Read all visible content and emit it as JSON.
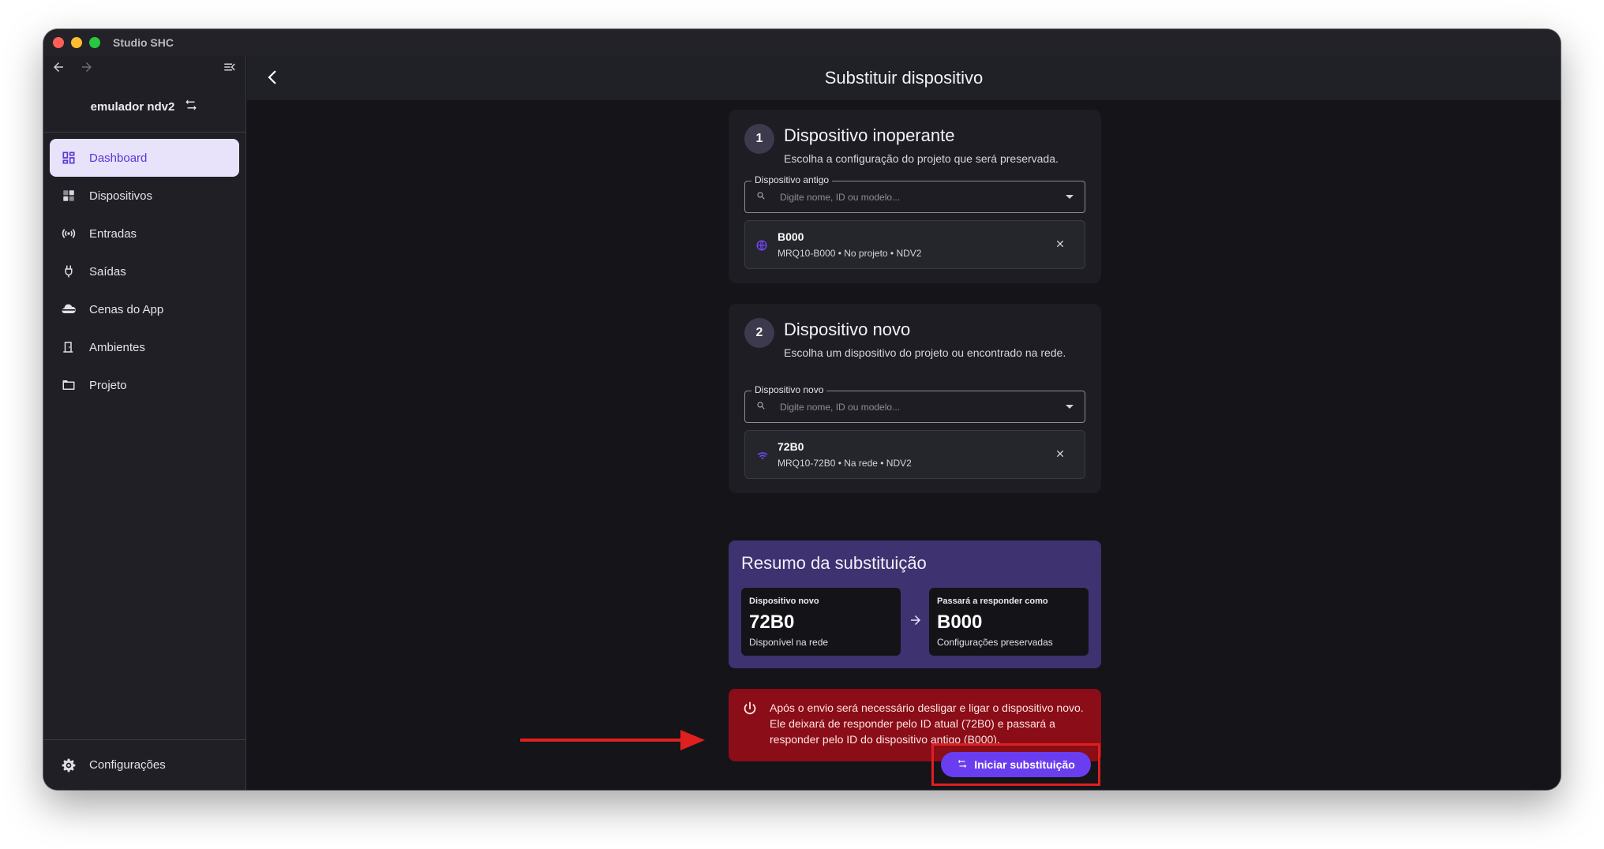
{
  "window": {
    "app_title": "Studio SHC"
  },
  "sidebar": {
    "project_name": "emulador ndv2",
    "items": [
      {
        "label": "Dashboard",
        "icon": "dashboard-icon",
        "active": true
      },
      {
        "label": "Dispositivos",
        "icon": "devices-icon",
        "active": false
      },
      {
        "label": "Entradas",
        "icon": "wifi-tethering-icon",
        "active": false
      },
      {
        "label": "Saídas",
        "icon": "power-plug-icon",
        "active": false
      },
      {
        "label": "Cenas do App",
        "icon": "cloud-icon",
        "active": false
      },
      {
        "label": "Ambientes",
        "icon": "door-icon",
        "active": false
      },
      {
        "label": "Projeto",
        "icon": "folder-icon",
        "active": false
      }
    ],
    "settings_label": "Configurações"
  },
  "header": {
    "title": "Substituir dispositivo"
  },
  "step1": {
    "number": "1",
    "title": "Dispositivo inoperante",
    "subtitle": "Escolha a configuração do projeto que será preservada.",
    "field_label": "Dispositivo antigo",
    "placeholder": "Digite nome, ID ou modelo...",
    "selected": {
      "name": "B000",
      "meta": "MRQ10-B000 • No projeto • NDV2"
    }
  },
  "step2": {
    "number": "2",
    "title": "Dispositivo novo",
    "subtitle": "Escolha um dispositivo do projeto ou encontrado na rede.",
    "field_label": "Dispositivo novo",
    "placeholder": "Digite nome, ID ou modelo...",
    "selected": {
      "name": "72B0",
      "meta": "MRQ10-72B0 • Na rede • NDV2"
    }
  },
  "summary": {
    "title": "Resumo da substituição",
    "new_device": {
      "label": "Dispositivo novo",
      "value": "72B0",
      "note": "Disponível na rede"
    },
    "respond_as": {
      "label": "Passará a responder como",
      "value": "B000",
      "note": "Configurações preservadas"
    }
  },
  "alert": {
    "text": "Após o envio será necessário desligar e ligar o dispositivo novo. Ele deixará de responder pelo ID atual (72B0) e passará a responder pelo ID do dispositivo antigo (B000)."
  },
  "actions": {
    "start_label": "Iniciar substituição"
  },
  "colors": {
    "accent": "#6a3df0",
    "active_item_bg": "#e8e2fb",
    "summary_bg": "#3e3270",
    "alert_bg": "#8a0d17",
    "annotation": "#e01f1f"
  }
}
